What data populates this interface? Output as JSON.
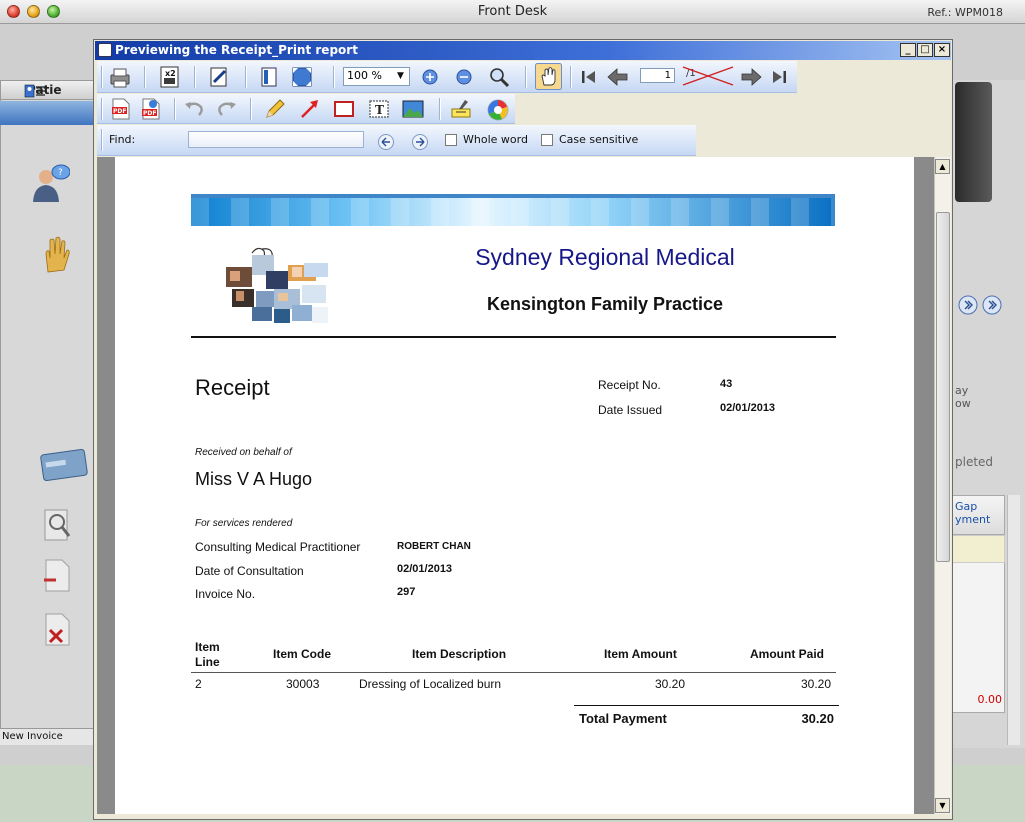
{
  "app": {
    "title": "Front Desk",
    "ref": "Ref.: WPM018",
    "left_tab_label": "Patie",
    "status_text": "New Invoice"
  },
  "right_panel": {
    "text_pay_1": "ay",
    "text_pay_2": "ow",
    "text_completed": "pleted",
    "gap_header_1": "Gap",
    "gap_header_2": "yment",
    "amount_zero": "0.00"
  },
  "dialog": {
    "title": "Previewing the Receipt_Print report",
    "zoom_value": "100 %",
    "page_current": "1",
    "page_total": "/1",
    "find_label": "Find:",
    "find_value": "",
    "whole_word_label": "Whole word",
    "case_sensitive_label": "Case sensitive",
    "whole_word_checked": false,
    "case_sensitive_checked": false
  },
  "report": {
    "organisation": "Sydney Regional Medical",
    "practice": "Kensington Family Practice",
    "title": "Receipt",
    "receipt_no_label": "Receipt No.",
    "receipt_no": "43",
    "date_issued_label": "Date Issued",
    "date_issued": "02/01/2013",
    "behalf_caption": "Received on behalf of",
    "patient_name": "Miss V A Hugo",
    "services_caption": "For services rendered",
    "practitioner_label": "Consulting Medical Practitioner",
    "practitioner": "ROBERT CHAN",
    "consultation_date_label": "Date of Consultation",
    "consultation_date": "02/01/2013",
    "invoice_no_label": "Invoice No.",
    "invoice_no": "297",
    "columns": {
      "item_line_1": "Item",
      "item_line_2": "Line",
      "item_code": "Item Code",
      "item_description": "Item Description",
      "item_amount": "Item Amount",
      "amount_paid": "Amount Paid"
    },
    "rows": [
      {
        "line": "2",
        "code": "30003",
        "description": "Dressing of Localized burn",
        "amount": "30.20",
        "paid": "30.20"
      }
    ],
    "total_label": "Total Payment",
    "total_value": "30.20"
  },
  "colors": {
    "organisation_text": "#16188a",
    "dialog_title_bar": "#123ba6",
    "toolbar": "#c6d8f4"
  }
}
